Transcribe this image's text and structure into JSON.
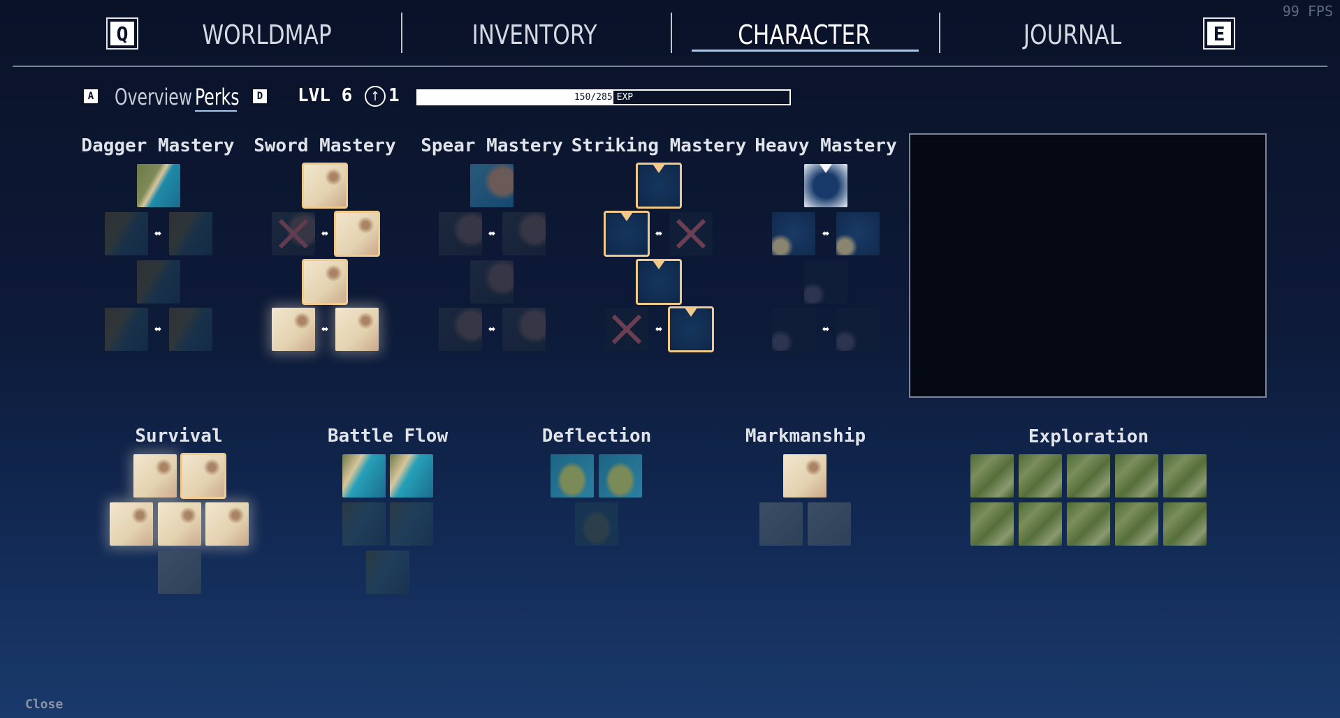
{
  "fps": "99 FPS",
  "nav": {
    "left_key": "Q",
    "right_key": "E",
    "tabs": [
      "WORLDMAP",
      "INVENTORY",
      "CHARACTER",
      "JOURNAL"
    ],
    "active_tab": "CHARACTER"
  },
  "subnav": {
    "left_key": "A",
    "right_key": "D",
    "tabs": [
      "Overview",
      "Perks"
    ],
    "active": "Perks",
    "level": "LVL 6",
    "perk_points": "1",
    "exp_text": "150/285",
    "exp_label": "EXP",
    "exp_current": 150,
    "exp_max": 285
  },
  "masteries": [
    {
      "title": "Dagger Mastery"
    },
    {
      "title": "Sword Mastery"
    },
    {
      "title": "Spear Mastery"
    },
    {
      "title": "Striking Mastery"
    },
    {
      "title": "Heavy Mastery"
    }
  ],
  "trees": [
    {
      "title": "Survival"
    },
    {
      "title": "Battle Flow"
    },
    {
      "title": "Deflection"
    },
    {
      "title": "Markmanship"
    },
    {
      "title": "Exploration"
    }
  ],
  "swap_glyph": "⬌",
  "close_label": "Close"
}
